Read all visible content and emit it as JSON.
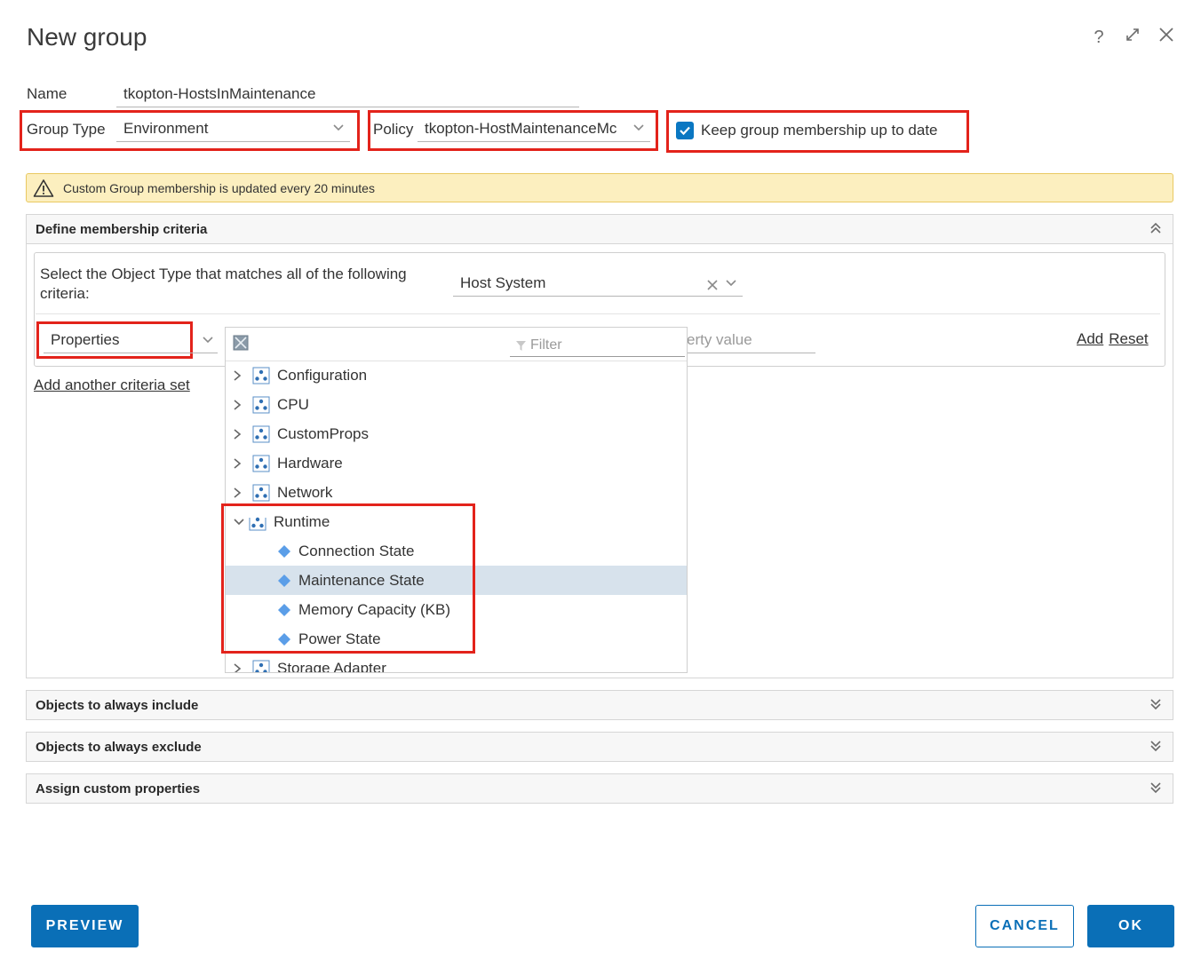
{
  "dialog": {
    "title": "New group",
    "help_glyph": "?"
  },
  "name_field": {
    "label": "Name",
    "value": "tkopton-HostsInMaintenance"
  },
  "group_type": {
    "label": "Group Type",
    "value": "Environment"
  },
  "policy": {
    "label": "Policy",
    "value": "tkopton-HostMaintenanceMc"
  },
  "keep_updated": {
    "label": "Keep group membership up to date",
    "checked": true
  },
  "banner": {
    "text": "Custom Group membership is updated every 20 minutes"
  },
  "sections": {
    "define": "Define membership criteria",
    "include": "Objects to always include",
    "exclude": "Objects to always exclude",
    "custom": "Assign custom properties"
  },
  "criteria": {
    "object_type_label_1": "Select the Object Type that matches all of the following",
    "object_type_label_2": "criteria:",
    "object_type_value": "Host System",
    "criteria_type": "Properties",
    "property_value_placeholder": "erty value",
    "add_link": "Add",
    "reset_link": "Reset",
    "add_set_link": "Add another criteria set"
  },
  "dropdown": {
    "filter_placeholder": "Filter",
    "groups": [
      {
        "label": "Configuration"
      },
      {
        "label": "CPU"
      },
      {
        "label": "CustomProps"
      },
      {
        "label": "Hardware"
      },
      {
        "label": "Network"
      },
      {
        "label": "Runtime"
      },
      {
        "label": "Storage Adapter"
      }
    ],
    "runtime_items": [
      {
        "label": "Connection State"
      },
      {
        "label": "Maintenance State",
        "selected": true
      },
      {
        "label": "Memory Capacity (KB)"
      },
      {
        "label": "Power State"
      }
    ]
  },
  "buttons": {
    "preview": "PREVIEW",
    "cancel": "CANCEL",
    "ok": "OK"
  },
  "colors": {
    "accent": "#0a6fb7",
    "highlight": "#e3231b",
    "banner": "#fcefbf",
    "selected_row": "#d7e2ec"
  }
}
